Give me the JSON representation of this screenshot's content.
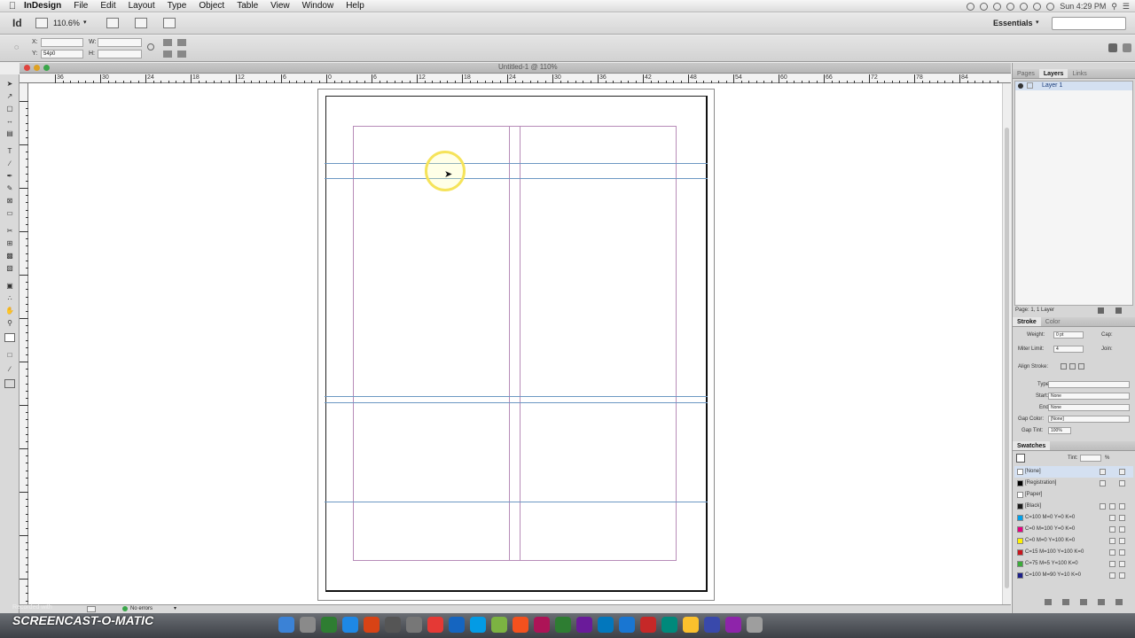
{
  "menubar": {
    "items": [
      "InDesign",
      "File",
      "Edit",
      "Layout",
      "Type",
      "Object",
      "Table",
      "View",
      "Window",
      "Help"
    ],
    "clock": "Sun 4:29 PM"
  },
  "appbar": {
    "app_logo": "Id",
    "zoom": "110.6%",
    "workspace": "Essentials"
  },
  "control": {
    "x_label": "X:",
    "y_label": "Y:",
    "w_label": "W:",
    "h_label": "H:",
    "y_value": "54p0"
  },
  "document": {
    "tab_name": "Untitled-1 @ 110%"
  },
  "ruler": {
    "h_labels": [
      "36",
      "30",
      "24",
      "18",
      "12",
      "6",
      "0",
      "6",
      "12",
      "18",
      "24",
      "30",
      "36",
      "42",
      "48",
      "54",
      "60",
      "66",
      "72",
      "78",
      "84"
    ],
    "v_labels": [
      "0",
      "1",
      "2",
      "3",
      "4",
      "5",
      "6",
      "7",
      "8",
      "9",
      "10",
      "11",
      "12"
    ]
  },
  "layers_panel": {
    "tabs": [
      "Pages",
      "Layers",
      "Links"
    ],
    "active_tab": "Layers",
    "layer_name": "Layer 1",
    "footer": "Page: 1, 1 Layer"
  },
  "stroke_panel": {
    "tabs": [
      "Stroke",
      "Color"
    ],
    "weight_label": "Weight:",
    "weight_value": "0 pt",
    "cap_label": "Cap:",
    "miter_label": "Miter Limit:",
    "miter_value": "4",
    "join_label": "Join:",
    "align_label": "Align Stroke:",
    "type_label": "Type:",
    "start_label": "Start:",
    "start_value": "None",
    "end_label": "End:",
    "end_value": "None",
    "gap_color_label": "Gap Color:",
    "gap_color_value": "[None]",
    "gap_tint_label": "Gap Tint:",
    "gap_tint_value": "100%"
  },
  "swatches_panel": {
    "title": "Swatches",
    "tint_label": "Tint:",
    "tint_unit": "%",
    "items": [
      {
        "name": "[None]",
        "color": "#ffffff"
      },
      {
        "name": "[Registration]",
        "color": "#000000"
      },
      {
        "name": "[Paper]",
        "color": "#ffffff"
      },
      {
        "name": "[Black]",
        "color": "#1a1a1a"
      },
      {
        "name": "C=100 M=0 Y=0 K=0",
        "color": "#00a0e9"
      },
      {
        "name": "C=0 M=100 Y=0 K=0",
        "color": "#e4007f"
      },
      {
        "name": "C=0 M=0 Y=100 K=0",
        "color": "#fff100"
      },
      {
        "name": "C=15 M=100 Y=100 K=0",
        "color": "#c8161d"
      },
      {
        "name": "C=75 M=5 Y=100 K=0",
        "color": "#3cab3a"
      },
      {
        "name": "C=100 M=90 Y=10 K=0",
        "color": "#1d2088"
      }
    ]
  },
  "status": {
    "errors": "No errors"
  },
  "watermark": {
    "small": "Recorded with",
    "brand": "SCREENCAST-O-MATIC"
  }
}
